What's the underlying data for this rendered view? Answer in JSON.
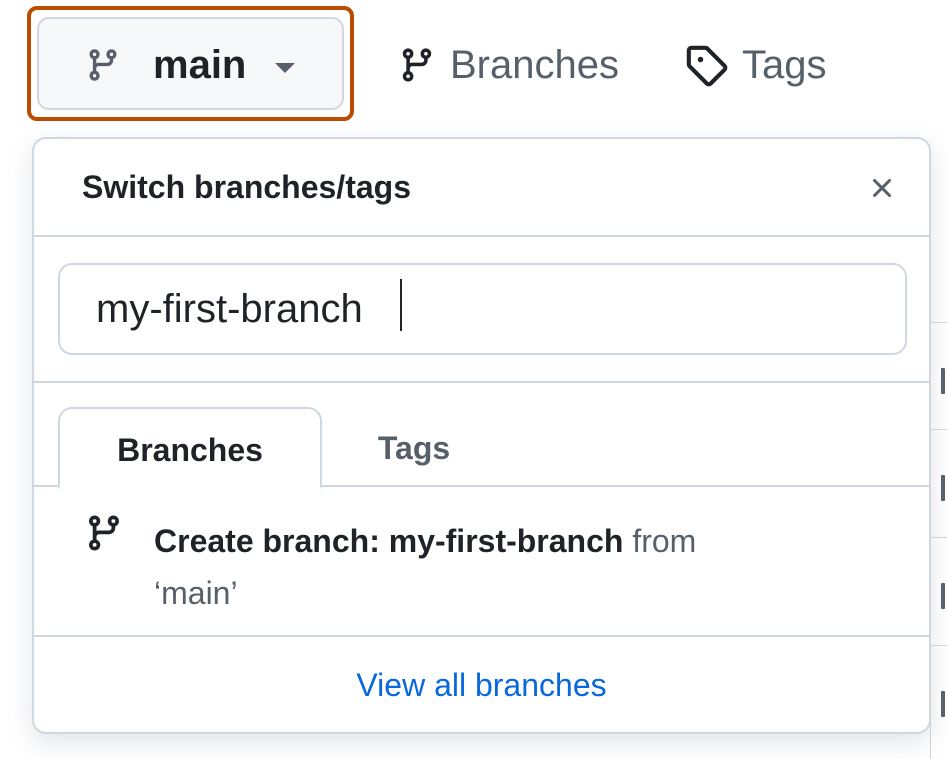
{
  "branch_selector": {
    "current": "main",
    "icon": "git-branch-icon"
  },
  "nav": {
    "branches_label": "Branches",
    "tags_label": "Tags"
  },
  "popover": {
    "title": "Switch branches/tags",
    "filter_value": "my-first-branch",
    "tabs": [
      {
        "label": "Branches",
        "selected": true
      },
      {
        "label": "Tags",
        "selected": false
      }
    ],
    "create": {
      "prefix": "Create branch: ",
      "name": "my-first-branch",
      "from_word": " from",
      "source": "‘main’"
    },
    "view_all": "View all branches"
  },
  "colors": {
    "highlight": "#bc4c00",
    "link": "#0969da",
    "muted": "#57606a",
    "border": "#d0d7de"
  }
}
